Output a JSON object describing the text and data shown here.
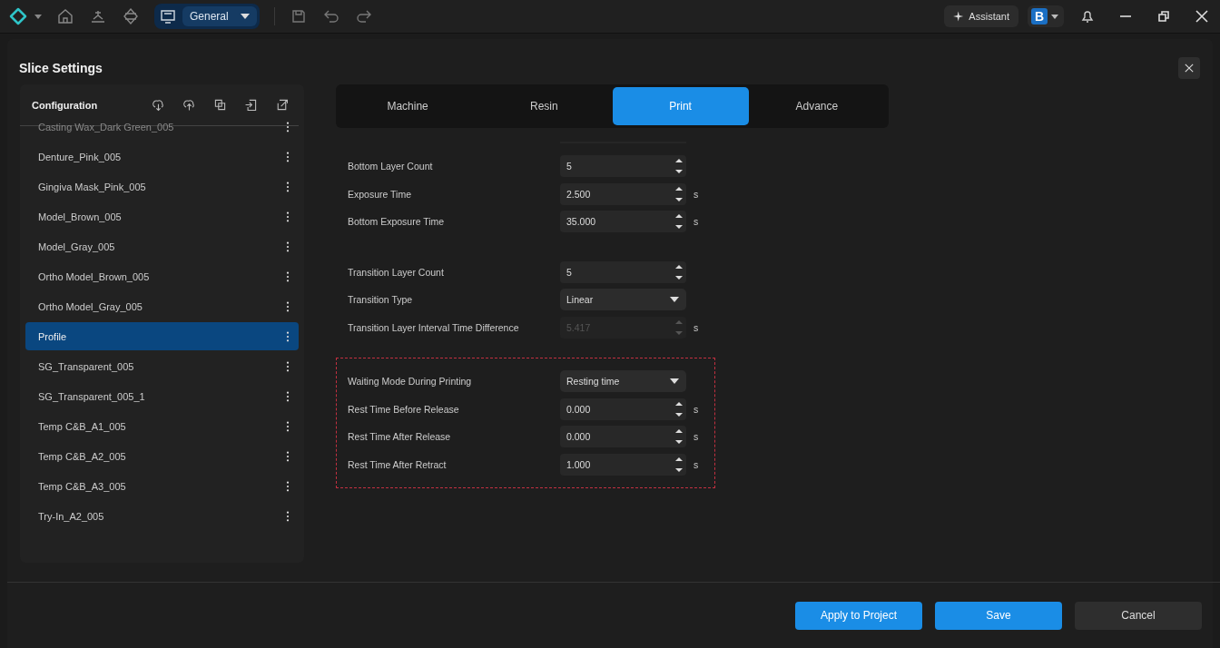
{
  "toolbar": {
    "workspace": "General",
    "assistant": "Assistant",
    "account_letter": "B"
  },
  "dialog": {
    "title": "Slice Settings"
  },
  "sidebar": {
    "title": "Configuration",
    "items": [
      {
        "label": "Casting Wax_Dark Green_005",
        "selected": false
      },
      {
        "label": "Denture_Pink_005",
        "selected": false
      },
      {
        "label": "Gingiva Mask_Pink_005",
        "selected": false
      },
      {
        "label": "Model_Brown_005",
        "selected": false
      },
      {
        "label": "Model_Gray_005",
        "selected": false
      },
      {
        "label": "Ortho Model_Brown_005",
        "selected": false
      },
      {
        "label": "Ortho Model_Gray_005",
        "selected": false
      },
      {
        "label": "Profile",
        "selected": true
      },
      {
        "label": "SG_Transparent_005",
        "selected": false
      },
      {
        "label": "SG_Transparent_005_1",
        "selected": false
      },
      {
        "label": "Temp C&B_A1_005",
        "selected": false
      },
      {
        "label": "Temp C&B_A2_005",
        "selected": false
      },
      {
        "label": "Temp C&B_A3_005",
        "selected": false
      },
      {
        "label": "Try-In_A2_005",
        "selected": false
      }
    ]
  },
  "tabs": [
    {
      "label": "Machine",
      "selected": false
    },
    {
      "label": "Resin",
      "selected": false
    },
    {
      "label": "Print",
      "selected": true
    },
    {
      "label": "Advance",
      "selected": false
    }
  ],
  "groups": [
    {
      "highlighted": false,
      "rows": [
        {
          "kind": "spin",
          "label": "Bottom Layer Count",
          "value": "5",
          "disabled": false
        },
        {
          "kind": "spin",
          "label": "Exposure Time",
          "value": "2.500",
          "unit": "s",
          "disabled": false
        },
        {
          "kind": "spin",
          "label": "Bottom Exposure Time",
          "value": "35.000",
          "unit": "s",
          "disabled": false
        }
      ]
    },
    {
      "highlighted": false,
      "rows": [
        {
          "kind": "spin",
          "label": "Transition Layer Count",
          "value": "5",
          "disabled": false
        },
        {
          "kind": "select",
          "label": "Transition Type",
          "value": "Linear",
          "disabled": false
        },
        {
          "kind": "spin",
          "label": "Transition Layer Interval Time Difference",
          "value": "5.417",
          "unit": "s",
          "disabled": true
        }
      ]
    },
    {
      "highlighted": true,
      "rows": [
        {
          "kind": "select",
          "label": "Waiting Mode During Printing",
          "value": "Resting time",
          "disabled": false
        },
        {
          "kind": "spin",
          "label": "Rest Time Before Release",
          "value": "0.000",
          "unit": "s",
          "disabled": false
        },
        {
          "kind": "spin",
          "label": "Rest Time After Release",
          "value": "0.000",
          "unit": "s",
          "disabled": false
        },
        {
          "kind": "spin",
          "label": "Rest Time After Retract",
          "value": "1.000",
          "unit": "s",
          "disabled": false
        }
      ]
    }
  ],
  "buttons": [
    {
      "label": "Apply to Project",
      "kind": "primary"
    },
    {
      "label": "Save",
      "kind": "primary"
    },
    {
      "label": "Cancel",
      "kind": "secondary"
    }
  ]
}
